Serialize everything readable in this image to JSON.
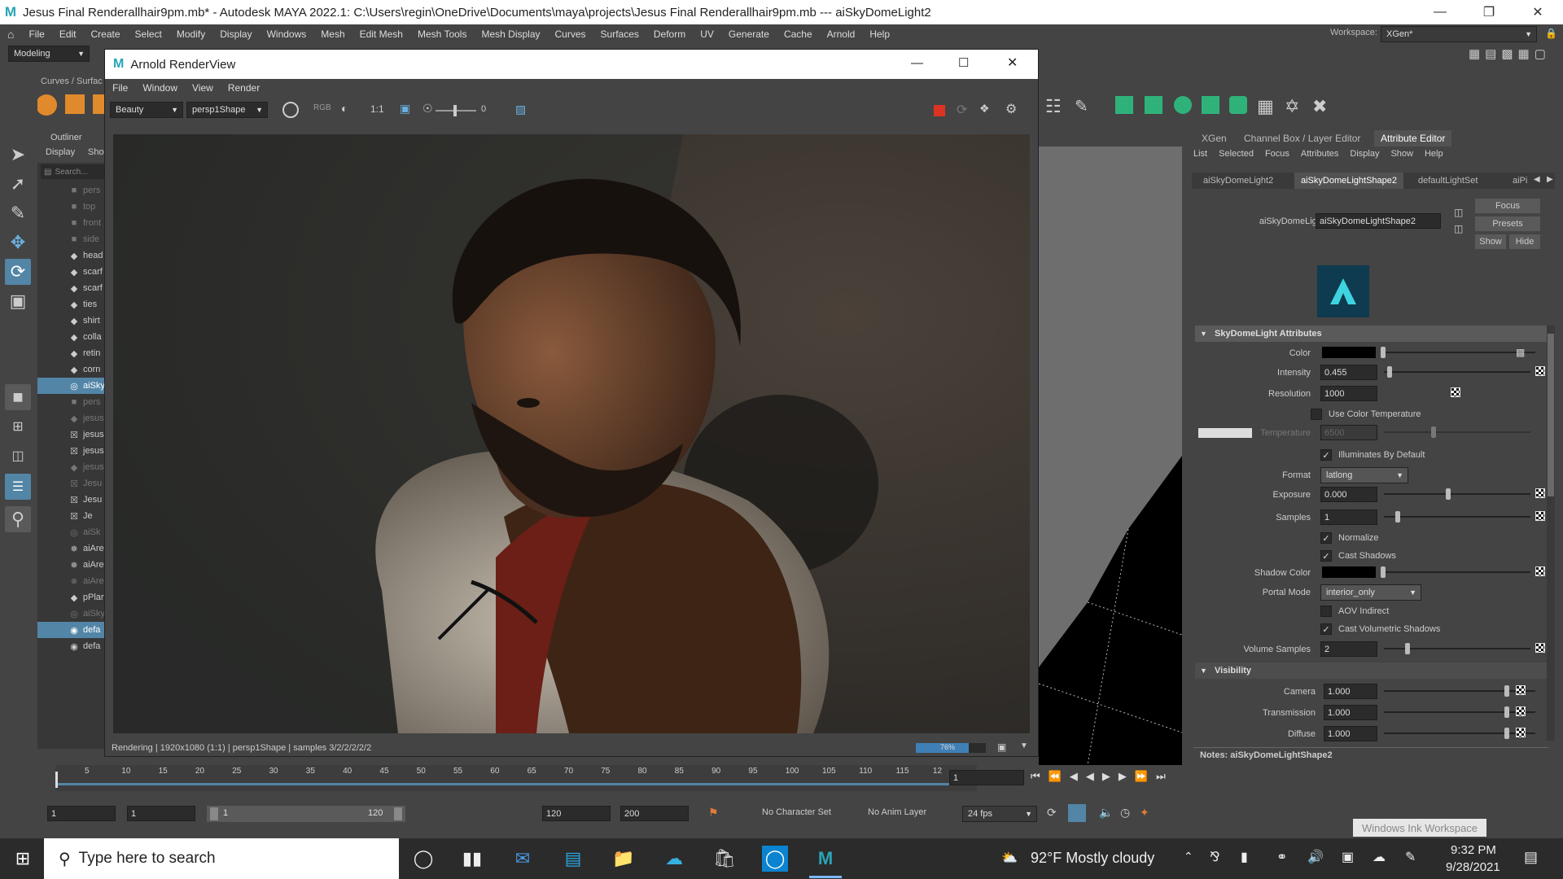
{
  "window": {
    "title": "Jesus Final Renderallhair9pm.mb* - Autodesk MAYA 2022.1: C:\\Users\\regin\\OneDrive\\Documents\\maya\\projects\\Jesus Final Renderallhair9pm.mb  ---  aiSkyDomeLight2"
  },
  "main_menu": [
    "File",
    "Edit",
    "Create",
    "Select",
    "Modify",
    "Display",
    "Windows",
    "Mesh",
    "Edit Mesh",
    "Mesh Tools",
    "Mesh Display",
    "Curves",
    "Surfaces",
    "Deform",
    "UV",
    "Generate",
    "Cache",
    "Arnold",
    "Help"
  ],
  "workspace": {
    "label": "Workspace:",
    "value": "XGen*"
  },
  "menuset": "Modeling",
  "shelf_tab": "Curves / Surfac",
  "outliner": {
    "title": "Outliner",
    "menu": [
      "Display",
      "Sho"
    ],
    "search_placeholder": "Search...",
    "items": [
      {
        "label": "pers",
        "icon": "camera-icon",
        "dim": true
      },
      {
        "label": "top",
        "icon": "camera-icon",
        "dim": true
      },
      {
        "label": "front",
        "icon": "camera-icon",
        "dim": true
      },
      {
        "label": "side",
        "icon": "camera-icon",
        "dim": true
      },
      {
        "label": "head",
        "icon": "mesh-icon",
        "dim": false
      },
      {
        "label": "scarf",
        "icon": "mesh-icon",
        "dim": false
      },
      {
        "label": "scarf",
        "icon": "mesh-icon",
        "dim": false
      },
      {
        "label": "ties",
        "icon": "mesh-icon",
        "dim": false
      },
      {
        "label": "shirt",
        "icon": "mesh-icon",
        "dim": false
      },
      {
        "label": "colla",
        "icon": "mesh-icon",
        "dim": false
      },
      {
        "label": "retin",
        "icon": "mesh-icon",
        "dim": false
      },
      {
        "label": "corn",
        "icon": "mesh-icon",
        "dim": false
      },
      {
        "label": "aiSky",
        "icon": "skydome-icon",
        "dim": false,
        "selected": true
      },
      {
        "label": "pers",
        "icon": "camera-icon",
        "dim": true
      },
      {
        "label": "jesus",
        "icon": "mesh-icon",
        "dim": true
      },
      {
        "label": "jesus",
        "icon": "xgen-icon",
        "dim": false
      },
      {
        "label": "jesus",
        "icon": "xgen-icon",
        "dim": false
      },
      {
        "label": "jesus",
        "icon": "mesh-icon",
        "dim": true
      },
      {
        "label": "Jesu",
        "icon": "xgen-icon",
        "dim": true
      },
      {
        "label": "Jesu",
        "icon": "xgen-icon",
        "dim": false
      },
      {
        "label": "Je",
        "icon": "xgen-icon",
        "dim": false
      },
      {
        "label": "aiSk",
        "icon": "skydome-icon",
        "dim": true
      },
      {
        "label": "aiAre",
        "icon": "arealight-icon",
        "dim": false
      },
      {
        "label": "aiAre",
        "icon": "arealight-icon",
        "dim": false
      },
      {
        "label": "aiAre",
        "icon": "arealight-icon",
        "dim": true
      },
      {
        "label": "pPlan",
        "icon": "mesh-icon",
        "dim": false
      },
      {
        "label": "aiSky",
        "icon": "skydome-icon",
        "dim": true
      },
      {
        "label": "defa",
        "icon": "set-icon",
        "dim": false,
        "selected": true
      },
      {
        "label": "defa",
        "icon": "set-icon",
        "dim": false
      }
    ]
  },
  "render_view": {
    "title": "Arnold RenderView",
    "menu": [
      "File",
      "Window",
      "View",
      "Render"
    ],
    "aov": "Beauty",
    "camera": "persp1Shape",
    "ratio": "1:1",
    "exposure": "0",
    "status": "Rendering | 1920x1080 (1:1) | persp1Shape | samples 3/2/2/2/2/2",
    "progress_label": "76%",
    "progress": 0.76
  },
  "attr": {
    "tabs_top": [
      "XGen",
      "Channel Box / Layer Editor",
      "Attribute Editor"
    ],
    "menu": [
      "List",
      "Selected",
      "Focus",
      "Attributes",
      "Display",
      "Show",
      "Help"
    ],
    "node_tabs": [
      "aiSkyDomeLight2",
      "aiSkyDomeLightShape2",
      "defaultLightSet",
      "aiPi"
    ],
    "node_label": "aiSkyDomeLight:",
    "node_value": "aiSkyDomeLightShape2",
    "buttons": {
      "focus": "Focus",
      "presets": "Presets",
      "show": "Show",
      "hide": "Hide"
    },
    "section_main": "SkyDomeLight Attributes",
    "color_label": "Color",
    "intensity_label": "Intensity",
    "intensity": "0.455",
    "resolution_label": "Resolution",
    "resolution": "1000",
    "use_color_temp": "Use Color Temperature",
    "temperature_label": "Temperature",
    "temperature": "6500",
    "illuminates_default": "Illuminates By Default",
    "format_label": "Format",
    "format": "latlong",
    "exposure_label": "Exposure",
    "exposure": "0.000",
    "samples_label": "Samples",
    "samples": "1",
    "normalize": "Normalize",
    "cast_shadows": "Cast Shadows",
    "shadow_color_label": "Shadow Color",
    "portal_label": "Portal Mode",
    "portal": "interior_only",
    "aov_indirect": "AOV Indirect",
    "cast_volumetric": "Cast Volumetric Shadows",
    "volume_samples_label": "Volume Samples",
    "volume_samples": "2",
    "section_visibility": "Visibility",
    "camera_label": "Camera",
    "camera": "1.000",
    "transmission_label": "Transmission",
    "transmission": "1.000",
    "diffuse_label": "Diffuse",
    "diffuse": "1.000",
    "notes": "Notes:  aiSkyDomeLightShape2"
  },
  "timeline": {
    "ticks": [
      "5",
      "10",
      "15",
      "20",
      "25",
      "30",
      "35",
      "40",
      "45",
      "50",
      "55",
      "60",
      "65",
      "70",
      "75",
      "80",
      "85",
      "90",
      "95",
      "100",
      "105",
      "110",
      "115",
      "12"
    ],
    "current": "1"
  },
  "range": {
    "start": "1",
    "start2": "1",
    "inner_start": "1",
    "inner_end": "120",
    "end": "120",
    "end2": "200",
    "char_set": "No Character Set",
    "anim_layer": "No Anim Layer",
    "fps": "24 fps"
  },
  "taskbar": {
    "search_placeholder": "Type here to search",
    "weather": "92°F  Mostly cloudy",
    "time": "9:32 PM",
    "date": "9/28/2021",
    "ink": "Windows Ink Workspace"
  }
}
